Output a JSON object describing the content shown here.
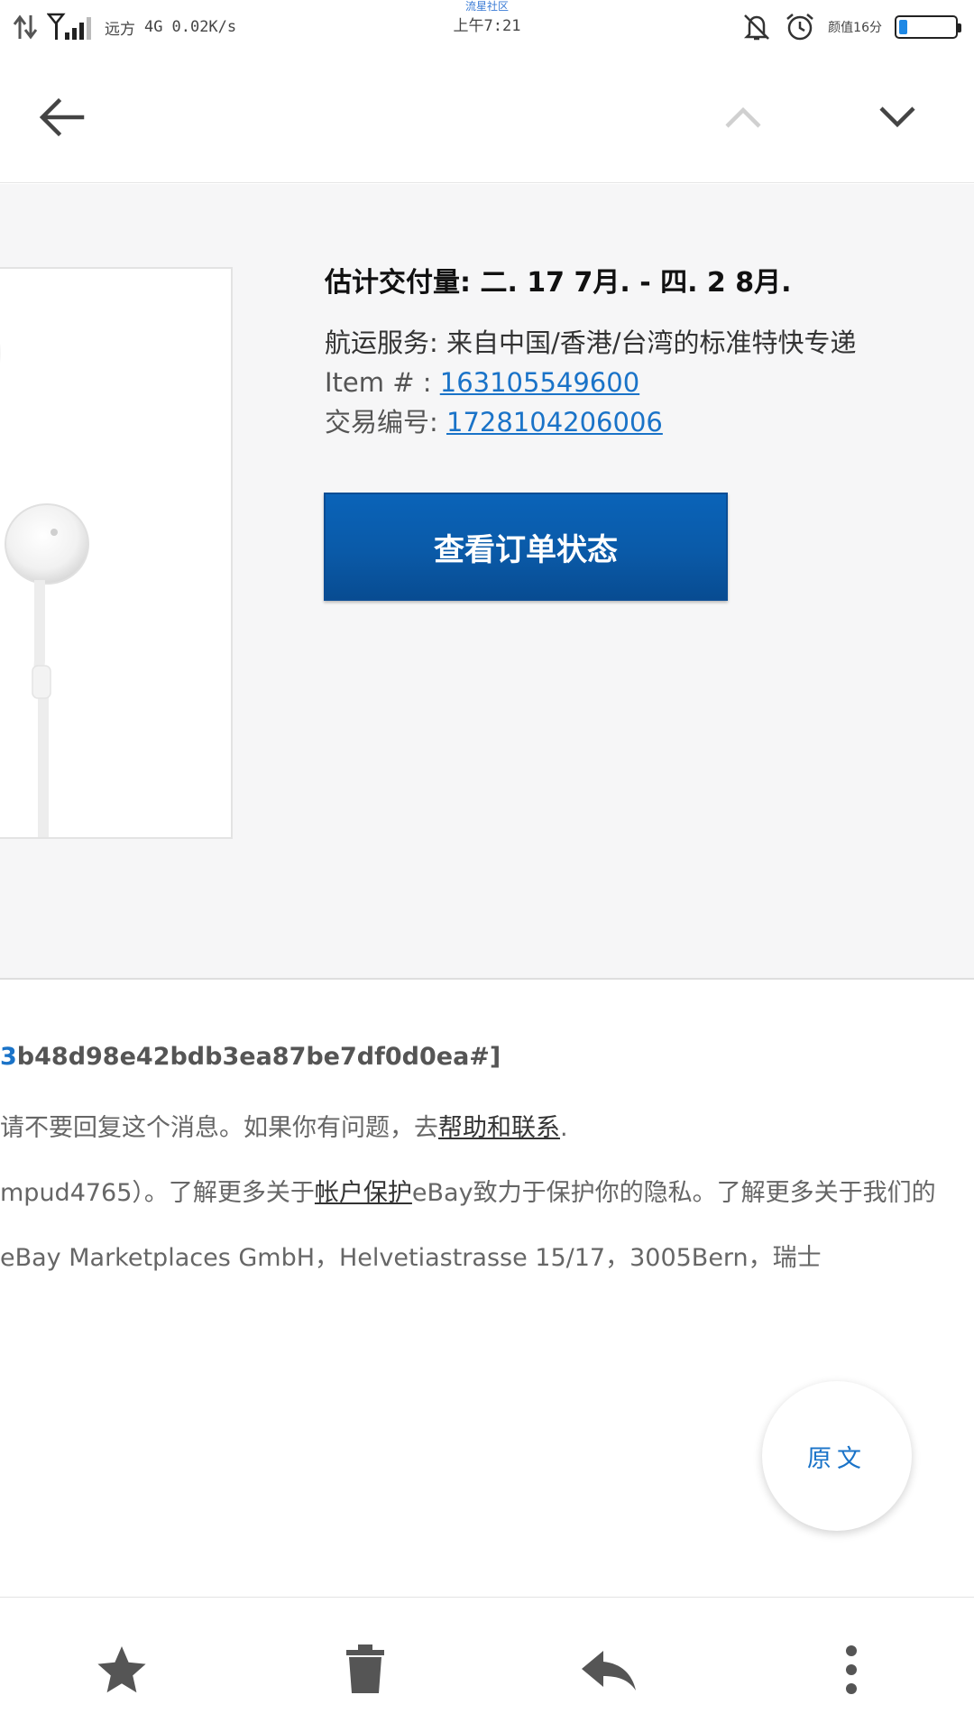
{
  "status_bar": {
    "carrier": "远方",
    "network": "4G",
    "speed": "0.02K/s",
    "center_caption": "流星社区",
    "time": "上午7:21",
    "app_label": "颜值16分",
    "battery_level": 0.15,
    "icons": [
      "data-transfer-icon",
      "signal-icon",
      "bell-muted-icon",
      "alarm-clock-icon",
      "battery-icon"
    ]
  },
  "toolbar": {
    "icons": [
      "back-arrow-icon",
      "chevron-up-icon",
      "chevron-down-icon"
    ]
  },
  "order": {
    "delivery": "估计交付量: 二. 17 7月. - 四. 2 8月.",
    "shipping_label": "航运服务: ",
    "shipping_value": "来自中国/香港/台湾的标准特快专递",
    "item_label": "Item # : ",
    "item_number": "163105549600",
    "transaction_label": "交易编号: ",
    "transaction_number": "1728104206006",
    "button_label": "查看订单状态"
  },
  "footer": {
    "hash_lead": "3",
    "hash_rest": "b48d98e42bdb3ea87be7df0d0ea#]",
    "line1_prefix": "请不要回复这个消息。如果你有问题，去",
    "line1_link": "帮助和联系",
    "line1_suffix": ".",
    "line2_prefix": "mpud4765）。了解更多关于",
    "line2_link": "帐户保护",
    "line2_suffix": "eBay致力于保护你的隐私。了解更多关于我们的",
    "line3": "eBay Marketplaces GmbH，Helvetiastrasse 15/17，3005Bern，瑞士"
  },
  "fab": {
    "label": "原文"
  },
  "bottom_bar": {
    "icons": [
      "star-icon",
      "trash-icon",
      "reply-icon",
      "more-vert-icon"
    ]
  }
}
